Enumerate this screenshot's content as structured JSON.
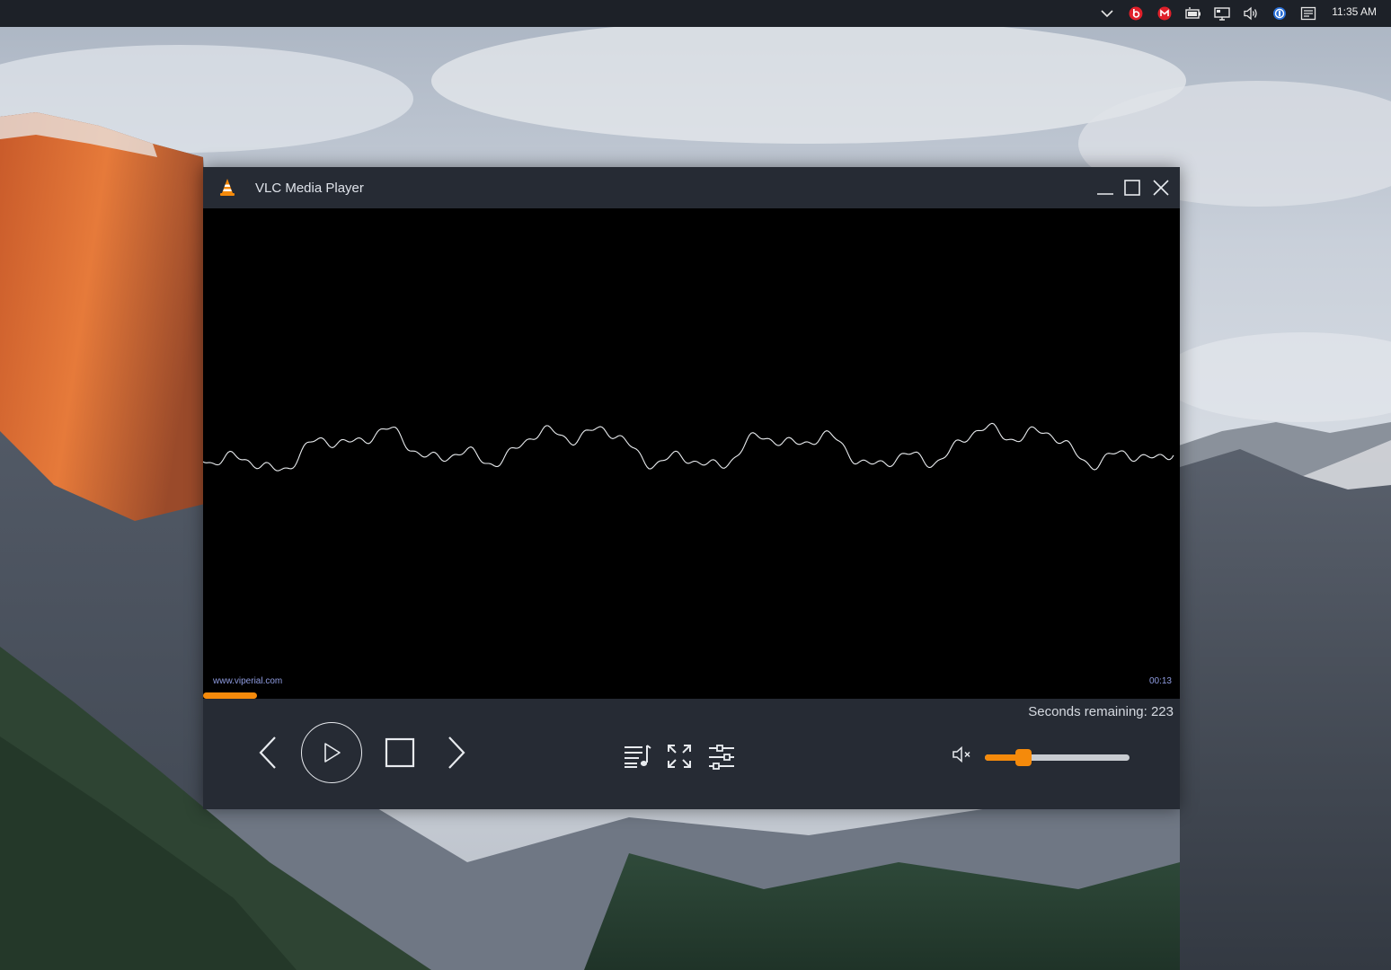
{
  "taskbar": {
    "tray_icons": [
      "chevron-up-icon",
      "beats-icon",
      "gmail-icon",
      "battery-icon",
      "network-icon",
      "speaker-icon",
      "shield-icon",
      "notification-icon"
    ],
    "clock": "11:35 AM"
  },
  "window": {
    "title": "VLC Media Player",
    "accent_color": "#f58a0b"
  },
  "video": {
    "watermark": "www.viperial.com",
    "elapsed": "00:13",
    "progress_fraction": 0.055
  },
  "controls": {
    "remaining_label": "Seconds remaining: 223",
    "volume_fraction": 0.24
  }
}
